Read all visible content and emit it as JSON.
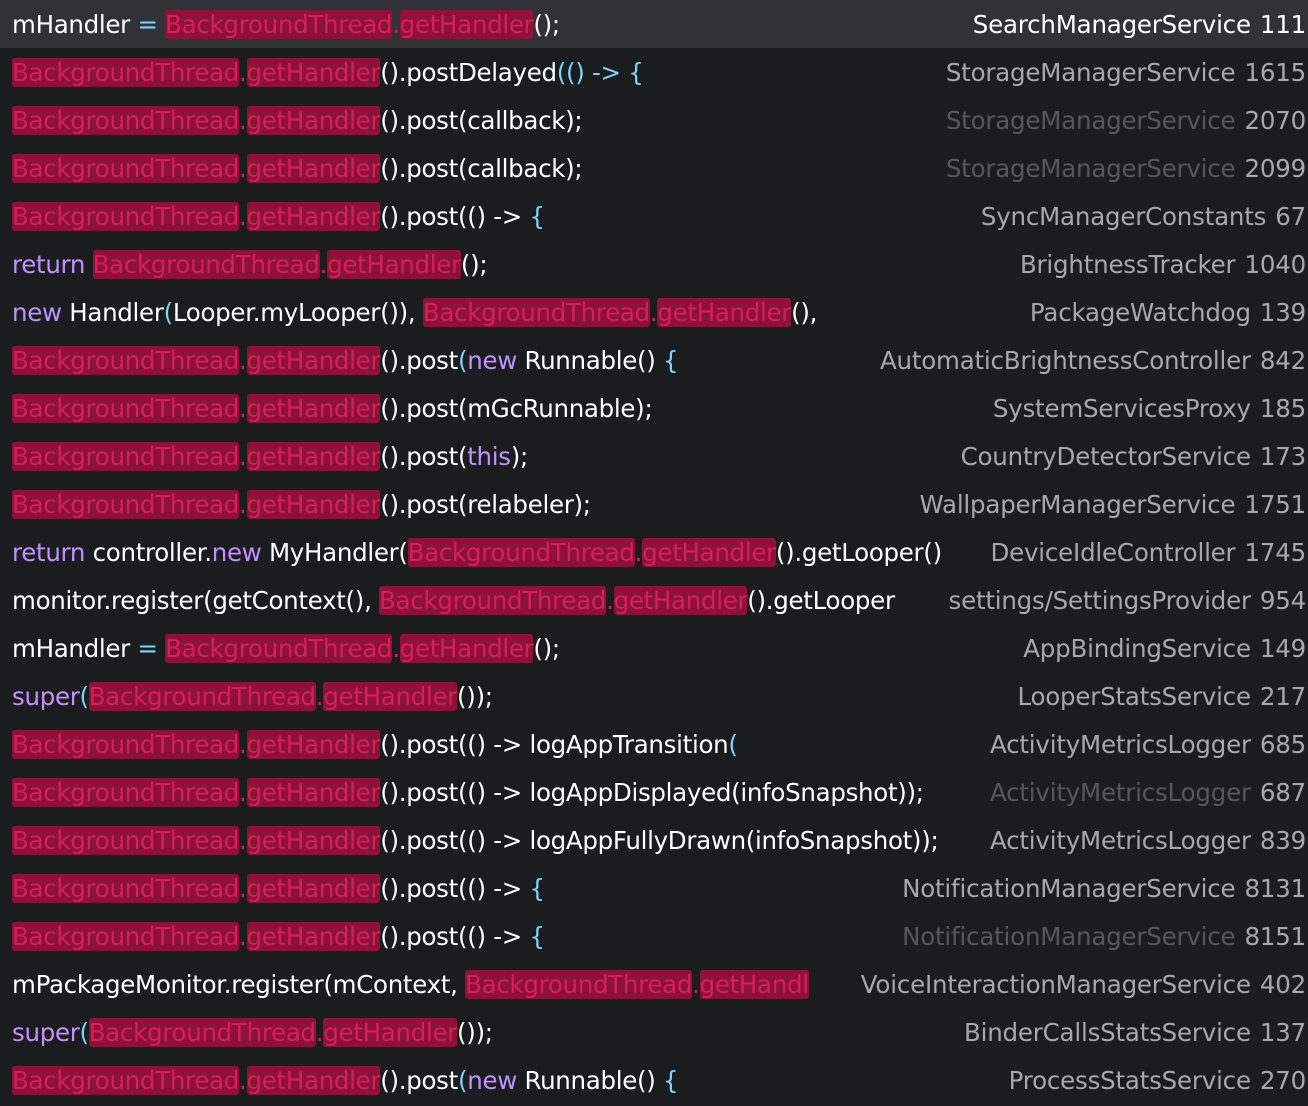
{
  "colors": {
    "background": "#1b1c1e",
    "selected_row": "#303236",
    "highlight_bg": "#8c1238",
    "highlight_fg": "#d61f5a",
    "keyword": "#c390ff",
    "punct": "#7fd2ff",
    "text": "#ffffff",
    "location": "#a6a8ac",
    "location_dim": "#55575b"
  },
  "results": [
    {
      "selected": true,
      "dim": false,
      "file": "SearchManagerService",
      "line": "111",
      "code": [
        [
          "t",
          "mHandler "
        ],
        [
          "p",
          "= "
        ],
        [
          "h",
          "BackgroundThread"
        ],
        [
          "d",
          "."
        ],
        [
          "h",
          "getHandler"
        ],
        [
          "t",
          "();"
        ]
      ]
    },
    {
      "selected": false,
      "dim": false,
      "file": "StorageManagerService",
      "line": "1615",
      "code": [
        [
          "h",
          "BackgroundThread"
        ],
        [
          "d",
          "."
        ],
        [
          "h",
          "getHandler"
        ],
        [
          "t",
          "().postDelayed"
        ],
        [
          "p",
          "(() -> {"
        ]
      ]
    },
    {
      "selected": false,
      "dim": true,
      "file": "StorageManagerService",
      "line": "2070",
      "code": [
        [
          "h",
          "BackgroundThread"
        ],
        [
          "d",
          "."
        ],
        [
          "h",
          "getHandler"
        ],
        [
          "t",
          "().post(callback);"
        ]
      ]
    },
    {
      "selected": false,
      "dim": true,
      "file": "StorageManagerService",
      "line": "2099",
      "code": [
        [
          "h",
          "BackgroundThread"
        ],
        [
          "d",
          "."
        ],
        [
          "h",
          "getHandler"
        ],
        [
          "t",
          "().post(callback);"
        ]
      ]
    },
    {
      "selected": false,
      "dim": false,
      "file": "SyncManagerConstants",
      "line": "67",
      "code": [
        [
          "h",
          "BackgroundThread"
        ],
        [
          "d",
          "."
        ],
        [
          "h",
          "getHandler"
        ],
        [
          "t",
          "().post(() -> "
        ],
        [
          "p",
          "{"
        ]
      ]
    },
    {
      "selected": false,
      "dim": false,
      "file": "BrightnessTracker",
      "line": "1040",
      "code": [
        [
          "k",
          "return "
        ],
        [
          "h",
          "BackgroundThread"
        ],
        [
          "d",
          "."
        ],
        [
          "h",
          "getHandler"
        ],
        [
          "t",
          "();"
        ]
      ]
    },
    {
      "selected": false,
      "dim": false,
      "file": "PackageWatchdog",
      "line": "139",
      "code": [
        [
          "k",
          "new "
        ],
        [
          "t",
          "Handler"
        ],
        [
          "p",
          "("
        ],
        [
          "t",
          "Looper.myLooper()), "
        ],
        [
          "h",
          "BackgroundThread"
        ],
        [
          "d",
          "."
        ],
        [
          "h",
          "getHandler"
        ],
        [
          "t",
          "(),"
        ]
      ]
    },
    {
      "selected": false,
      "dim": false,
      "file": "AutomaticBrightnessController",
      "line": "842",
      "code": [
        [
          "h",
          "BackgroundThread"
        ],
        [
          "d",
          "."
        ],
        [
          "h",
          "getHandler"
        ],
        [
          "t",
          "().post"
        ],
        [
          "p",
          "("
        ],
        [
          "k",
          "new "
        ],
        [
          "t",
          "Runnable() "
        ],
        [
          "p",
          "{"
        ]
      ]
    },
    {
      "selected": false,
      "dim": false,
      "file": "SystemServicesProxy",
      "line": "185",
      "code": [
        [
          "h",
          "BackgroundThread"
        ],
        [
          "d",
          "."
        ],
        [
          "h",
          "getHandler"
        ],
        [
          "t",
          "().post(mGcRunnable);"
        ]
      ]
    },
    {
      "selected": false,
      "dim": false,
      "file": "CountryDetectorService",
      "line": "173",
      "code": [
        [
          "h",
          "BackgroundThread"
        ],
        [
          "d",
          "."
        ],
        [
          "h",
          "getHandler"
        ],
        [
          "t",
          "().post("
        ],
        [
          "k",
          "this"
        ],
        [
          "t",
          ");"
        ]
      ]
    },
    {
      "selected": false,
      "dim": false,
      "file": "WallpaperManagerService",
      "line": "1751",
      "code": [
        [
          "h",
          "BackgroundThread"
        ],
        [
          "d",
          "."
        ],
        [
          "h",
          "getHandler"
        ],
        [
          "t",
          "().post(relabeler);"
        ]
      ]
    },
    {
      "selected": false,
      "dim": false,
      "file": "DeviceIdleController",
      "line": "1745",
      "code": [
        [
          "k",
          "return "
        ],
        [
          "t",
          "controller."
        ],
        [
          "k",
          "new "
        ],
        [
          "t",
          "MyHandler("
        ],
        [
          "h",
          "BackgroundThread"
        ],
        [
          "d",
          "."
        ],
        [
          "h",
          "getHandler"
        ],
        [
          "t",
          "().getLooper()"
        ]
      ]
    },
    {
      "selected": false,
      "dim": false,
      "file": "settings/SettingsProvider",
      "line": "954",
      "code": [
        [
          "t",
          "monitor.register(getContext(), "
        ],
        [
          "h",
          "BackgroundThread"
        ],
        [
          "d",
          "."
        ],
        [
          "h",
          "getHandler"
        ],
        [
          "t",
          "().getLooper"
        ]
      ]
    },
    {
      "selected": false,
      "dim": false,
      "file": "AppBindingService",
      "line": "149",
      "code": [
        [
          "t",
          "mHandler "
        ],
        [
          "p",
          "= "
        ],
        [
          "h",
          "BackgroundThread"
        ],
        [
          "d",
          "."
        ],
        [
          "h",
          "getHandler"
        ],
        [
          "t",
          "();"
        ]
      ]
    },
    {
      "selected": false,
      "dim": false,
      "file": "LooperStatsService",
      "line": "217",
      "code": [
        [
          "k",
          "super"
        ],
        [
          "p",
          "("
        ],
        [
          "h",
          "BackgroundThread"
        ],
        [
          "d",
          "."
        ],
        [
          "h",
          "getHandler"
        ],
        [
          "t",
          "());"
        ]
      ]
    },
    {
      "selected": false,
      "dim": false,
      "file": "ActivityMetricsLogger",
      "line": "685",
      "code": [
        [
          "h",
          "BackgroundThread"
        ],
        [
          "d",
          "."
        ],
        [
          "h",
          "getHandler"
        ],
        [
          "t",
          "().post(() -> logAppTransition"
        ],
        [
          "p",
          "("
        ]
      ]
    },
    {
      "selected": false,
      "dim": true,
      "file": "ActivityMetricsLogger",
      "line": "687",
      "code": [
        [
          "h",
          "BackgroundThread"
        ],
        [
          "d",
          "."
        ],
        [
          "h",
          "getHandler"
        ],
        [
          "t",
          "().post(() -> logAppDisplayed(infoSnapshot));"
        ]
      ]
    },
    {
      "selected": false,
      "dim": false,
      "file": "ActivityMetricsLogger",
      "line": "839",
      "code": [
        [
          "h",
          "BackgroundThread"
        ],
        [
          "d",
          "."
        ],
        [
          "h",
          "getHandler"
        ],
        [
          "t",
          "().post(() -> logAppFullyDrawn(infoSnapshot));"
        ]
      ]
    },
    {
      "selected": false,
      "dim": false,
      "file": "NotificationManagerService",
      "line": "8131",
      "code": [
        [
          "h",
          "BackgroundThread"
        ],
        [
          "d",
          "."
        ],
        [
          "h",
          "getHandler"
        ],
        [
          "t",
          "().post(() -> "
        ],
        [
          "p",
          "{"
        ]
      ]
    },
    {
      "selected": false,
      "dim": true,
      "file": "NotificationManagerService",
      "line": "8151",
      "code": [
        [
          "h",
          "BackgroundThread"
        ],
        [
          "d",
          "."
        ],
        [
          "h",
          "getHandler"
        ],
        [
          "t",
          "().post(() -> "
        ],
        [
          "p",
          "{"
        ]
      ]
    },
    {
      "selected": false,
      "dim": false,
      "file": "VoiceInteractionManagerService",
      "line": "402",
      "code": [
        [
          "t",
          "mPackageMonitor.register(mContext, "
        ],
        [
          "h",
          "BackgroundThread"
        ],
        [
          "d",
          "."
        ],
        [
          "h",
          "getHandl"
        ]
      ]
    },
    {
      "selected": false,
      "dim": false,
      "file": "BinderCallsStatsService",
      "line": "137",
      "code": [
        [
          "k",
          "super"
        ],
        [
          "p",
          "("
        ],
        [
          "h",
          "BackgroundThread"
        ],
        [
          "d",
          "."
        ],
        [
          "h",
          "getHandler"
        ],
        [
          "t",
          "());"
        ]
      ]
    },
    {
      "selected": false,
      "dim": false,
      "file": "ProcessStatsService",
      "line": "270",
      "code": [
        [
          "h",
          "BackgroundThread"
        ],
        [
          "d",
          "."
        ],
        [
          "h",
          "getHandler"
        ],
        [
          "t",
          "().post"
        ],
        [
          "p",
          "("
        ],
        [
          "k",
          "new "
        ],
        [
          "t",
          "Runnable() "
        ],
        [
          "p",
          "{"
        ]
      ]
    }
  ]
}
